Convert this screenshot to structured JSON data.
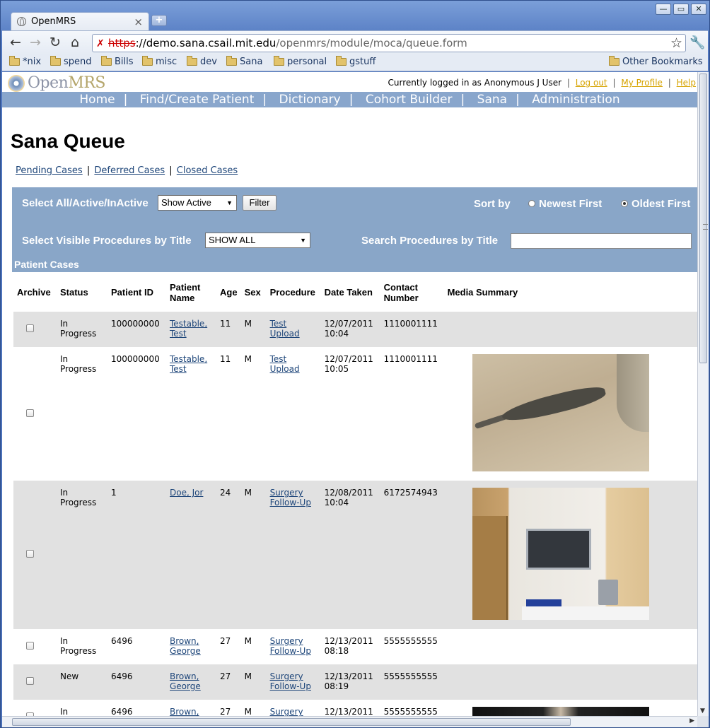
{
  "browser": {
    "tab_title": "OpenMRS",
    "window_controls": {
      "minimize": "—",
      "maximize": "▭",
      "close": "✕"
    },
    "url": {
      "scheme": "https",
      "sep": "://",
      "host": "demo.sana.csail.mit.edu",
      "path": "/openmrs/module/moca/queue.form"
    },
    "bookmarks": [
      "*nix",
      "spend",
      "Bills",
      "misc",
      "dev",
      "Sana",
      "personal",
      "gstuff"
    ],
    "other_bookmarks": "Other Bookmarks"
  },
  "header": {
    "logo_open": "Open",
    "logo_mrs": "MRS",
    "login_text": "Currently logged in as Anonymous J User",
    "logout": "Log out",
    "my_profile": "My Profile",
    "help": "Help",
    "separator": "|"
  },
  "nav": [
    "Home",
    "Find/Create Patient",
    "Dictionary",
    "Cohort Builder",
    "Sana",
    "Administration"
  ],
  "page_title": "Sana Queue",
  "sublinks": [
    "Pending Cases",
    "Deferred Cases",
    "Closed Cases"
  ],
  "filters": {
    "select_label": "Select All/Active/InActive",
    "active_select": "Show Active",
    "filter_button": "Filter",
    "sort_label": "Sort by",
    "sort_newest": "Newest First",
    "sort_oldest": "Oldest First",
    "sort_selected": "oldest",
    "procedures_label": "Select Visible Procedures by Title",
    "procedures_select": "SHOW ALL",
    "search_label": "Search Procedures by Title",
    "search_value": "",
    "section_title": "Patient Cases"
  },
  "table": {
    "headers": [
      "Archive",
      "Status",
      "Patient ID",
      "Patient Name",
      "Age",
      "Sex",
      "Procedure",
      "Date Taken",
      "Contact Number",
      "Media Summary"
    ],
    "rows": [
      {
        "status": "In Progress",
        "patient_id": "100000000",
        "name": "Testable, Test",
        "age": "11",
        "sex": "M",
        "procedure": "Test Upload",
        "date": "12/07/2011 10:04",
        "contact": "1110001111",
        "media": ""
      },
      {
        "status": "In Progress",
        "patient_id": "100000000",
        "name": "Testable, Test",
        "age": "11",
        "sex": "M",
        "procedure": "Test Upload",
        "date": "12/07/2011 10:05",
        "contact": "1110001111",
        "media": "iguana-photo"
      },
      {
        "status": "In Progress",
        "patient_id": "1",
        "name": "Doe, Jor",
        "age": "24",
        "sex": "M",
        "procedure": "Surgery Follow-Up",
        "date": "12/08/2011 10:04",
        "contact": "6172574943",
        "media": "room-photo"
      },
      {
        "status": "In Progress",
        "patient_id": "6496",
        "name": "Brown, George",
        "age": "27",
        "sex": "M",
        "procedure": "Surgery Follow-Up",
        "date": "12/13/2011 08:18",
        "contact": "5555555555",
        "media": ""
      },
      {
        "status": "New",
        "patient_id": "6496",
        "name": "Brown, George",
        "age": "27",
        "sex": "M",
        "procedure": "Surgery Follow-Up",
        "date": "12/13/2011 08:19",
        "contact": "5555555555",
        "media": ""
      },
      {
        "status": "In",
        "patient_id": "6496",
        "name": "Brown,",
        "age": "27",
        "sex": "M",
        "procedure": "Surgery",
        "date": "12/13/2011",
        "contact": "5555555555",
        "media": "dark-photo"
      }
    ]
  }
}
